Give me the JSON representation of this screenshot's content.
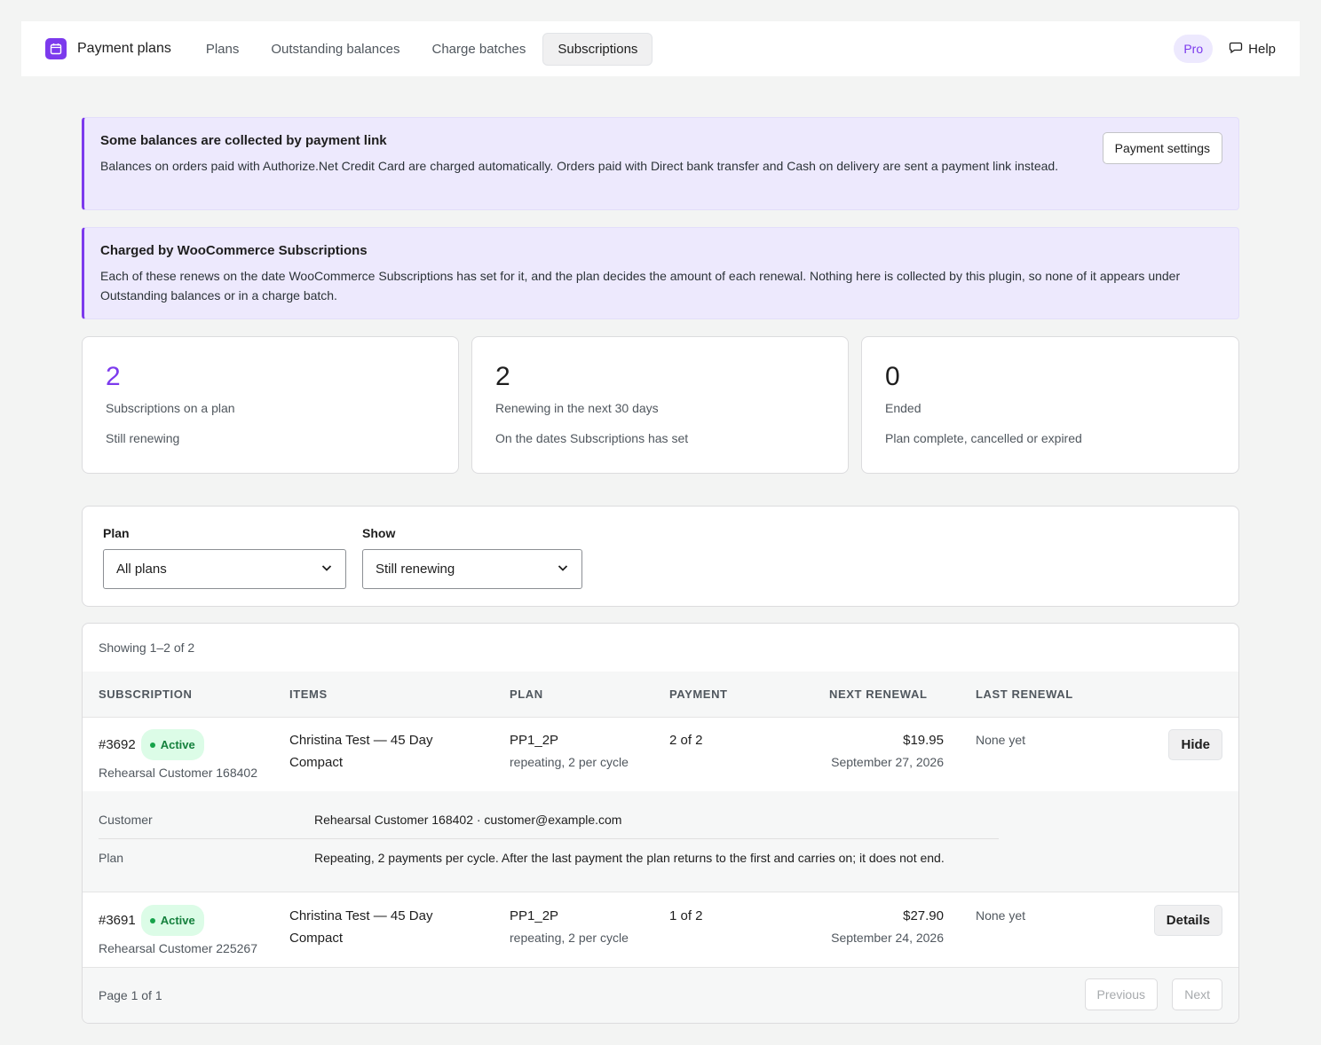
{
  "topbar": {
    "brand": "Payment plans",
    "tabs": [
      "Plans",
      "Outstanding balances",
      "Charge batches",
      "Subscriptions"
    ],
    "active_tab": "Subscriptions",
    "pro": "Pro",
    "help": "Help"
  },
  "notices": [
    {
      "title": "Some balances are collected by payment link",
      "text": "Balances on orders paid with Authorize.Net Credit Card are charged automatically. Orders paid with Direct bank transfer and Cash on delivery are sent a payment link instead.",
      "button": "Payment settings"
    },
    {
      "title": "Charged by WooCommerce Subscriptions",
      "text": "Each of these renews on the date WooCommerce Subscriptions has set for it, and the plan decides the amount of each renewal. Nothing here is collected by this plugin, so none of it appears under Outstanding balances or in a charge batch."
    }
  ],
  "stats": [
    {
      "value": "2",
      "label": "Subscriptions on a plan",
      "sub": "Still renewing"
    },
    {
      "value": "2",
      "label": "Renewing in the next 30 days",
      "sub": "On the dates Subscriptions has set"
    },
    {
      "value": "0",
      "label": "Ended",
      "sub": "Plan complete, cancelled or expired"
    }
  ],
  "filters": {
    "plan_label": "Plan",
    "plan_value": "All plans",
    "show_label": "Show",
    "show_value": "Still renewing"
  },
  "table": {
    "showing": "Showing 1–2 of 2",
    "headers": [
      "SUBSCRIPTION",
      "ITEMS",
      "PLAN",
      "PAYMENT",
      "NEXT RENEWAL",
      "LAST RENEWAL"
    ],
    "rows": [
      {
        "id": "#3692",
        "status": "Active",
        "customer": "Rehearsal Customer 168402",
        "items": "Christina Test — 45 Day Compact",
        "plan": "PP1_2P",
        "plan_sub": "repeating, 2 per cycle",
        "payment": "2 of 2",
        "next_amount": "$19.95",
        "next_date": "September 27, 2026",
        "last": "None yet",
        "action": "Hide"
      },
      {
        "id": "#3691",
        "status": "Active",
        "customer": "Rehearsal Customer 225267",
        "items": "Christina Test — 45 Day Compact",
        "plan": "PP1_2P",
        "plan_sub": "repeating, 2 per cycle",
        "payment": "1 of 2",
        "next_amount": "$27.90",
        "next_date": "September 24, 2026",
        "last": "None yet",
        "action": "Details"
      }
    ],
    "details": {
      "customer_label": "Customer",
      "customer_value": "Rehearsal Customer 168402 · customer@example.com",
      "plan_label": "Plan",
      "plan_value": "Repeating, 2 payments per cycle. After the last payment the plan returns to the first and carries on; it does not end."
    },
    "page_info": "Page 1 of 1",
    "prev": "Previous",
    "next": "Next"
  },
  "colors": {
    "accent": "#7c3aed",
    "active_bg": "#dcfce7",
    "active_text": "#15803d"
  }
}
